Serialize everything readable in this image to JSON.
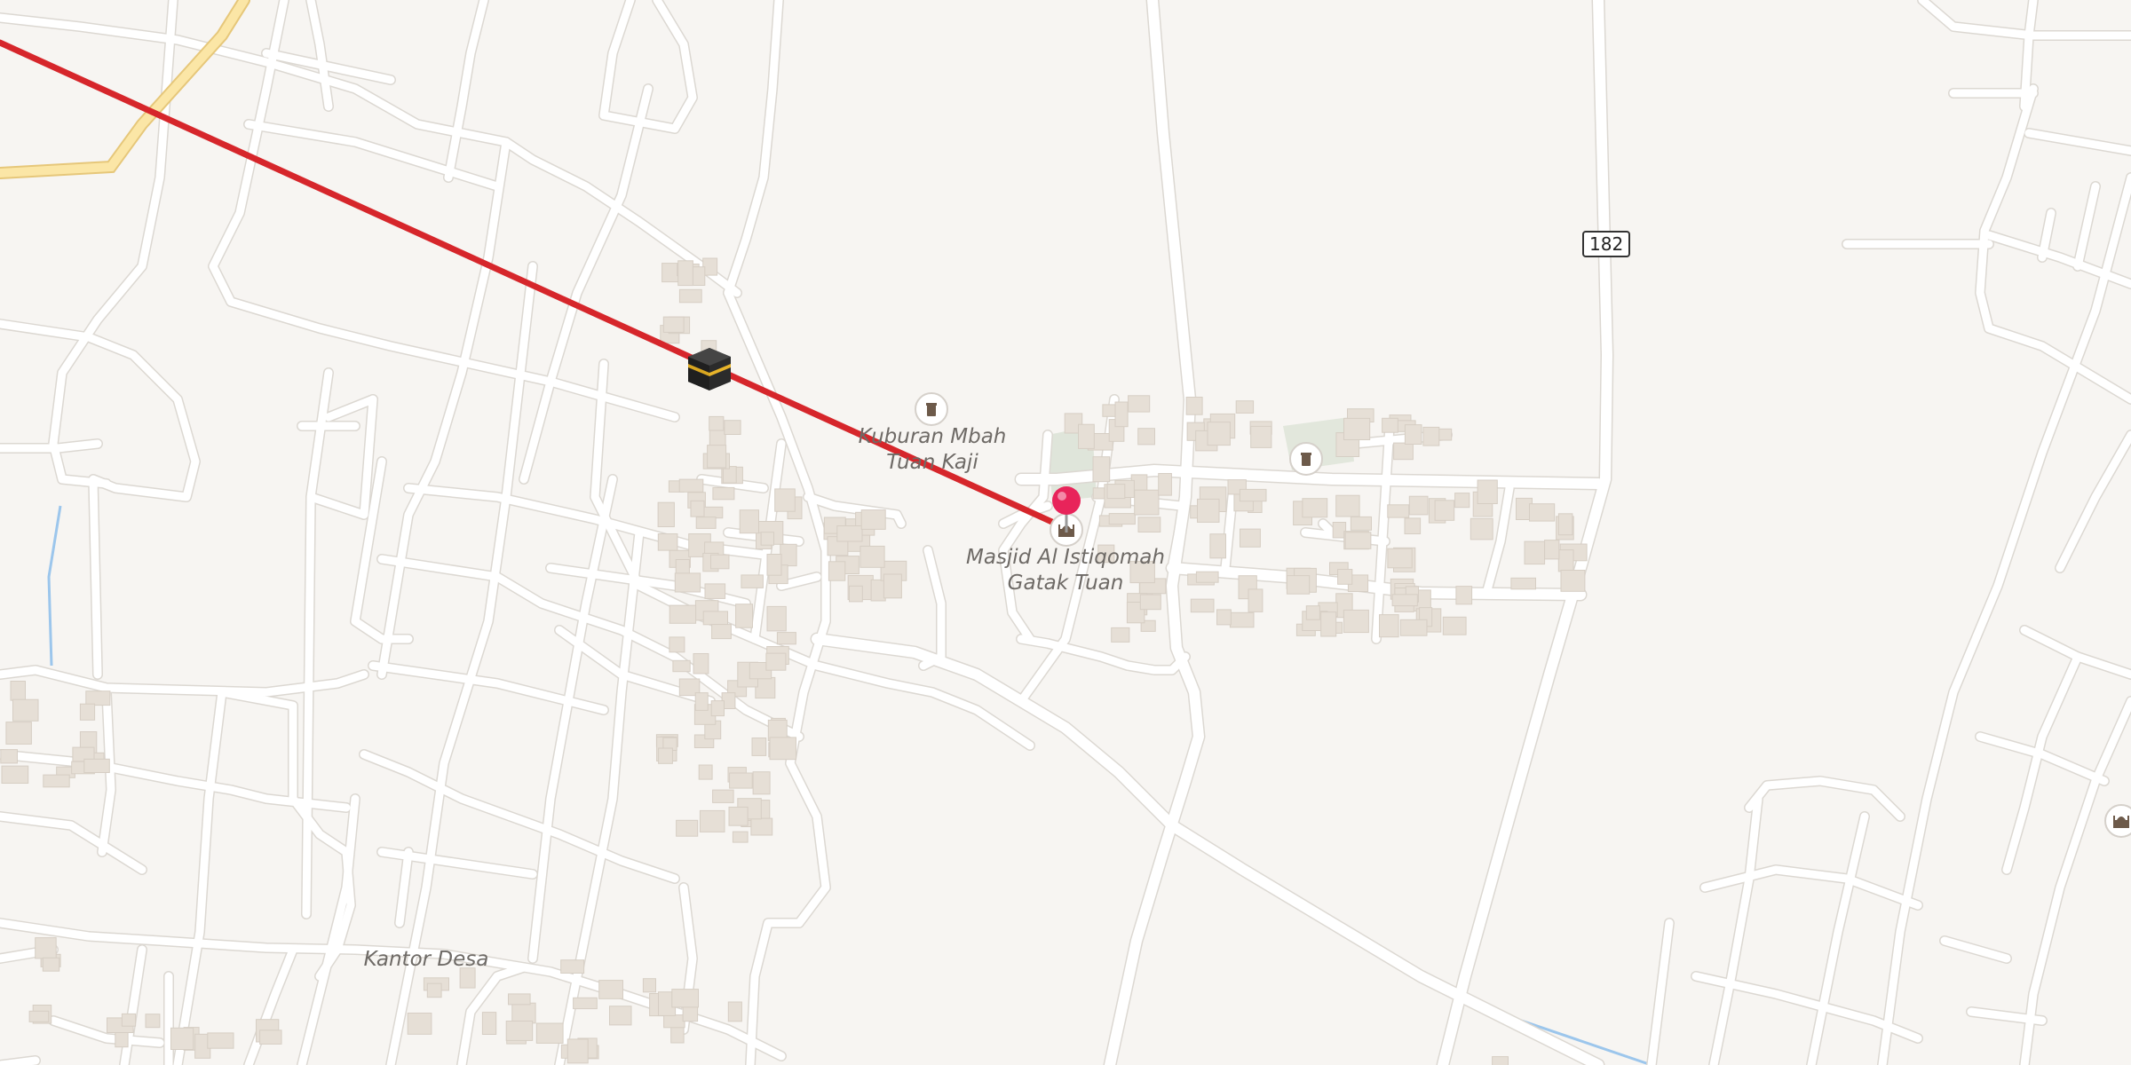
{
  "map": {
    "labels": {
      "kuburan_line1": "Kuburan Mbah",
      "kuburan_line2": "Tuan Kaji",
      "masjid_line1": "Masjid Al Istiqomah",
      "masjid_line2": "Gatak Tuan",
      "kantor_desa": "Kantor Desa"
    },
    "route_shield": "182",
    "icons": {
      "kaaba": "kaaba-icon",
      "pin": "location-pin-icon",
      "mosque": "mosque-icon",
      "cemetery": "cemetery-icon"
    },
    "colors": {
      "background": "#f7f5f2",
      "qibla_line": "#d6262b",
      "pin": "#e8245a",
      "major_road": "#f9e3a3",
      "water": "#8cbfe8"
    }
  }
}
